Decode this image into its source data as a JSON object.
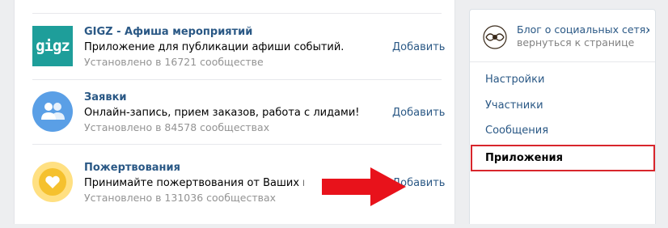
{
  "apps": [
    {
      "title": "GIGZ - Афиша мероприятий",
      "description": "Приложение для публикации афиши событий.",
      "installs": "Установлено в 16721 сообществе",
      "add_label": "Добавить",
      "icon": "gigz-logo",
      "icon_text": "gigz",
      "icon_color": "#1e9e9a"
    },
    {
      "title": "Заявки",
      "description": "Онлайн-запись, прием заказов, работа с лидами!",
      "installs": "Установлено в 84578 сообществах",
      "add_label": "Добавить",
      "icon": "users-icon",
      "icon_color": "#5a9fe6"
    },
    {
      "title": "Пожертвования",
      "description": "Принимайте пожертвования от Ваших подписчиков",
      "installs": "Установлено в 131036 сообществах",
      "add_label": "Добавить",
      "icon": "heart-icon",
      "icon_color": "#f5c12e"
    }
  ],
  "annotation": {
    "arrow_icon": "red-arrow-icon",
    "arrow_color": "#e8121b"
  },
  "sidebar": {
    "group_title": "Блог о социальных сетях",
    "back_link": "вернуться к странице",
    "logo_icon": "ornament-logo",
    "items": [
      {
        "label": "Настройки",
        "active": false
      },
      {
        "label": "Участники",
        "active": false
      },
      {
        "label": "Сообщения",
        "active": false
      },
      {
        "label": "Приложения",
        "active": true
      }
    ],
    "highlight_color": "#d8262c"
  },
  "colors": {
    "link": "#2a5885",
    "muted": "#939393",
    "background": "#edeef0"
  }
}
